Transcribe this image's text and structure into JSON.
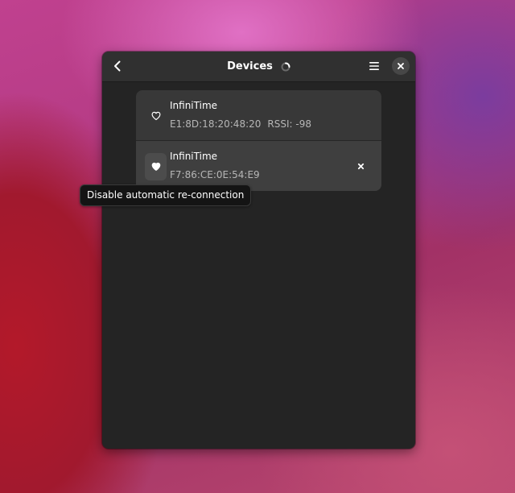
{
  "window": {
    "title": "Devices"
  },
  "headerbar": {
    "back_icon": "chevron-left-icon",
    "spinner_icon": "spinner-icon",
    "menu_icon": "hamburger-menu-icon",
    "close_icon": "close-icon"
  },
  "devices": [
    {
      "name": "InfiniTime",
      "address": "E1:8D:18:20:48:20",
      "rssi": "RSSI: -98",
      "favorite": false,
      "icon": "heart-outline-icon"
    },
    {
      "name": "InfiniTime",
      "address": "F7:86:CE:0E:54:E9",
      "favorite": true,
      "icon": "heart-filled-icon",
      "remove_icon": "close-icon"
    }
  ],
  "tooltip": {
    "text": "Disable automatic re-connection"
  },
  "colors": {
    "window_bg": "#242424",
    "headerbar_bg": "#303030",
    "row_bg": "#383838",
    "text_primary": "#ffffff",
    "text_secondary": "#b6b6b6"
  }
}
